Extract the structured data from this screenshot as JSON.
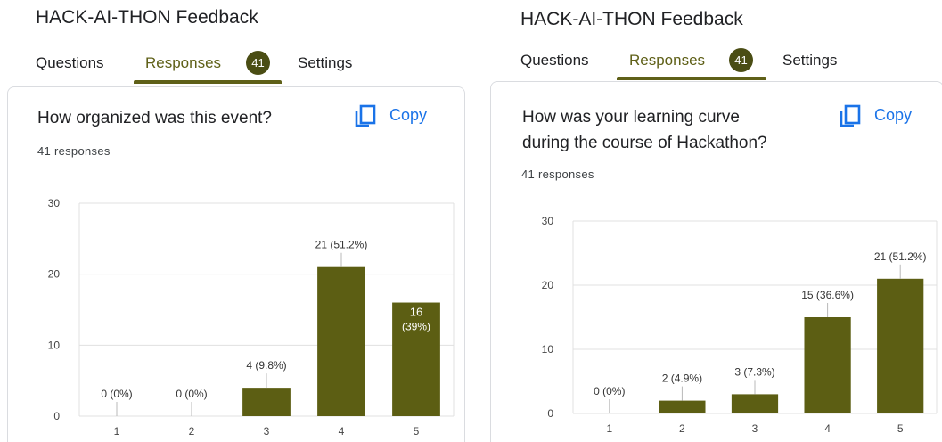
{
  "panels": [
    {
      "form_title": "HACK-AI-THON Feedback",
      "tabs": {
        "questions": "Questions",
        "responses": "Responses",
        "responses_count": "41",
        "settings": "Settings"
      },
      "question": "How organized was this event?",
      "copy_label": "Copy",
      "responses_text": "41 responses",
      "chart_data": {
        "type": "bar",
        "categories": [
          "1",
          "2",
          "3",
          "4",
          "5"
        ],
        "values": [
          0,
          0,
          4,
          21,
          16
        ],
        "data_labels": [
          "0 (0%)",
          "0 (0%)",
          "4 (9.8%)",
          "21 (51.2%)",
          "16 (39%)"
        ],
        "ylim": [
          0,
          30
        ],
        "yticks": [
          0,
          10,
          20,
          30
        ],
        "bar_color": "#5c5e13",
        "grid": true
      }
    },
    {
      "form_title": "HACK-AI-THON Feedback",
      "tabs": {
        "questions": "Questions",
        "responses": "Responses",
        "responses_count": "41",
        "settings": "Settings"
      },
      "question_lines": [
        "How was your learning curve",
        "during the course of Hackathon?"
      ],
      "copy_label": "Copy",
      "responses_text": "41 responses",
      "chart_data": {
        "type": "bar",
        "categories": [
          "1",
          "2",
          "3",
          "4",
          "5"
        ],
        "values": [
          0,
          2,
          3,
          15,
          21
        ],
        "data_labels": [
          "0 (0%)",
          "2 (4.9%)",
          "3 (7.3%)",
          "15 (36.6%)",
          "21 (51.2%)"
        ],
        "ylim": [
          0,
          30
        ],
        "yticks": [
          0,
          10,
          20,
          30
        ],
        "bar_color": "#5c5e13",
        "grid": true
      }
    }
  ],
  "colors": {
    "accent": "#5f6018",
    "copy": "#1a73e8",
    "badge": "#4a4d14"
  }
}
